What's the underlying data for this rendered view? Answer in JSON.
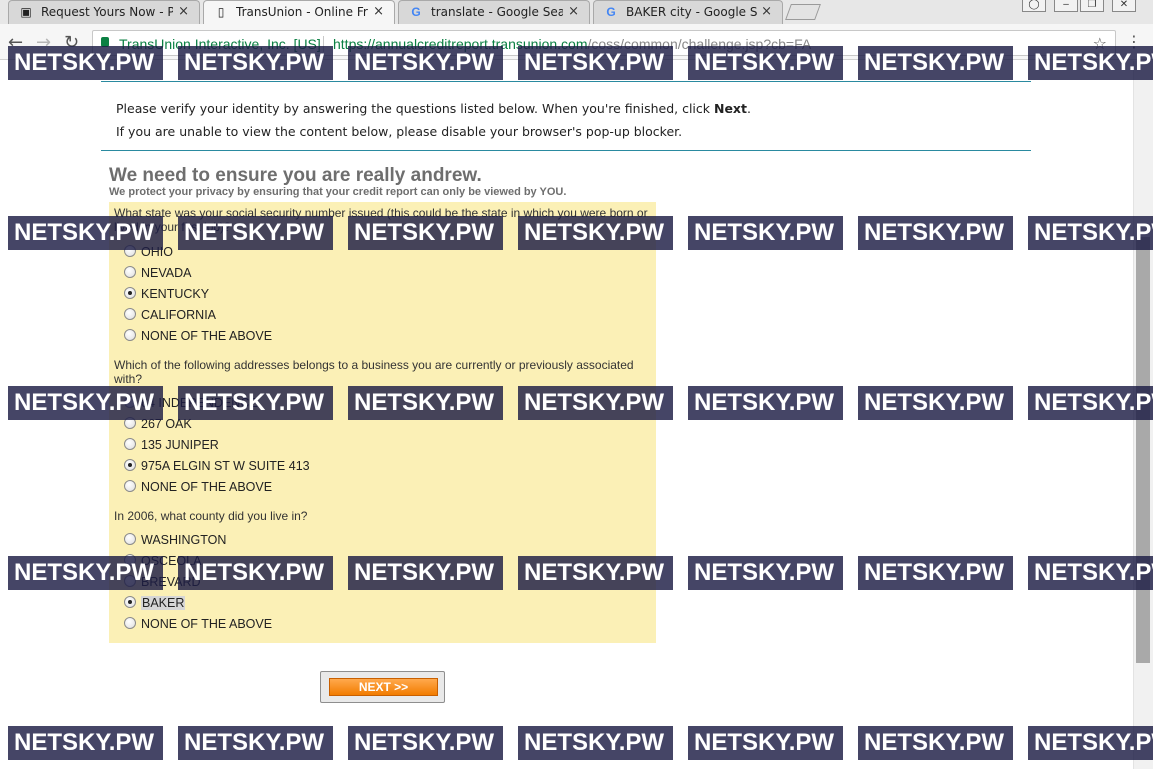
{
  "browser": {
    "tabs": [
      {
        "title": "Request Yours Now - Pic",
        "favicon": "picture-icon"
      },
      {
        "title": "TransUnion - Online Frau",
        "favicon": "page-icon"
      },
      {
        "title": "translate - Google Search",
        "favicon": "google-icon"
      },
      {
        "title": "BAKER city - Google Sear",
        "favicon": "google-icon"
      }
    ],
    "close_glyph": "×",
    "site_identity": "TransUnion Interactive, Inc. [US]",
    "url_host": "https://annualcreditreport.transunion.com",
    "url_path": "/coss/common/challenge.jsp?cb=FA"
  },
  "intro": {
    "line1": "Please verify your identity by answering the questions listed below. When you're finished, click ",
    "line1_bold": "Next",
    "line1_end": ".",
    "line2": "If you are unable to view the content below, please disable your browser's pop-up blocker."
  },
  "heading": "We need to ensure you are really andrew.",
  "subheading": "We protect your privacy by ensuring that your credit report can only be viewed by YOU.",
  "questions": [
    {
      "text": "What state was your social security number issued (this could be the state in which you were born or lived in your first job)?",
      "options": [
        "OHIO",
        "NEVADA",
        "KENTUCKY",
        "CALIFORNIA",
        "NONE OF THE ABOVE"
      ],
      "selected_index": 2
    },
    {
      "text": "Which of the following addresses belongs to a business you are currently or previously associated with?",
      "options": [
        "64 INDEPENDENCE",
        "267 OAK",
        "135 JUNIPER",
        "975A ELGIN ST W SUITE 413",
        "NONE OF THE ABOVE"
      ],
      "selected_index": 3
    },
    {
      "text": "In 2006, what county did you live in?",
      "options": [
        "WASHINGTON",
        "OSCEOLA",
        "BREVARD",
        "BAKER",
        "NONE OF THE ABOVE"
      ],
      "selected_index": 3
    }
  ],
  "next_button": "NEXT >>",
  "watermark": "NETSKY.PW",
  "colors": {
    "quiz_background": "#fbf0b6",
    "accent_rule": "#2a8aa0",
    "next_button": "#f27c00",
    "secure_green": "#0b8043",
    "watermark_bg": "#1c1c44"
  }
}
